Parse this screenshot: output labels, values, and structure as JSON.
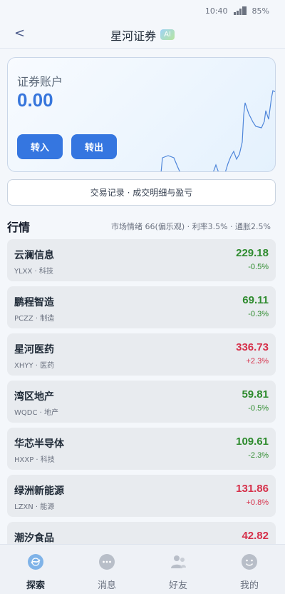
{
  "status": {
    "time": "10:40",
    "battery": "85%"
  },
  "header": {
    "back": "<",
    "title": "星河证券",
    "badge": "AI"
  },
  "account": {
    "label": "证券账户",
    "balance": "0.00",
    "transfer_in": "转入",
    "transfer_out": "转出"
  },
  "records_label": "交易记录 · 成交明细与盈亏",
  "market": {
    "title": "行情",
    "meta": "市场情绪 66(偏乐观) · 利率3.5% · 通胀2.5%",
    "stocks": [
      {
        "name": "云澜信息",
        "code": "YLXX · 科技",
        "price": "229.18",
        "change": "-0.5%",
        "color": "#2e8b2e"
      },
      {
        "name": "鹏程智造",
        "code": "PCZZ · 制造",
        "price": "69.11",
        "change": "-0.3%",
        "color": "#2e8b2e"
      },
      {
        "name": "星河医药",
        "code": "XHYY · 医药",
        "price": "336.73",
        "change": "+2.3%",
        "color": "#d6304a"
      },
      {
        "name": "湾区地产",
        "code": "WQDC · 地产",
        "price": "59.81",
        "change": "-0.5%",
        "color": "#2e8b2e"
      },
      {
        "name": "华芯半导体",
        "code": "HXXP · 科技",
        "price": "109.61",
        "change": "-2.3%",
        "color": "#2e8b2e"
      },
      {
        "name": "绿洲新能源",
        "code": "LZXN · 能源",
        "price": "131.86",
        "change": "+0.8%",
        "color": "#d6304a"
      },
      {
        "name": "潮汐食品",
        "code": "",
        "price": "42.82",
        "change": "",
        "color": "#d6304a"
      }
    ]
  },
  "tabs": [
    {
      "label": "探索",
      "icon": "explore-icon"
    },
    {
      "label": "消息",
      "icon": "message-icon"
    },
    {
      "label": "好友",
      "icon": "friends-icon"
    },
    {
      "label": "我的",
      "icon": "profile-icon"
    }
  ]
}
